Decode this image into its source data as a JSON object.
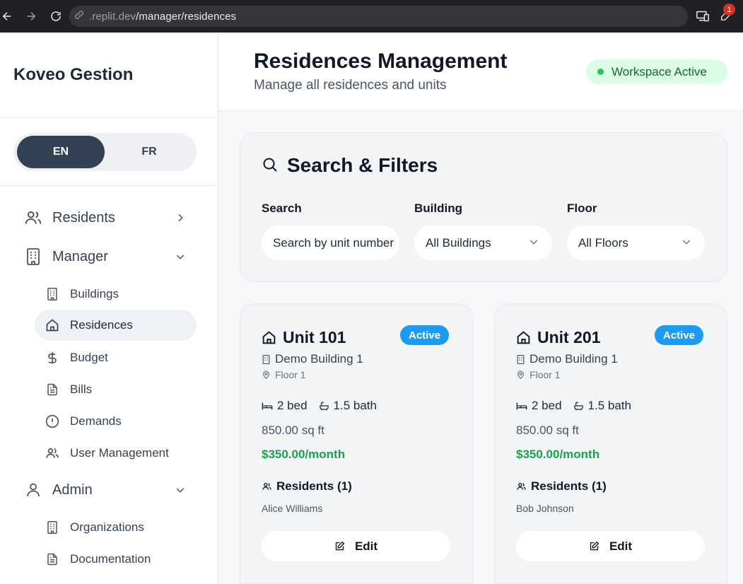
{
  "browser": {
    "url_domain": ".replit.dev",
    "url_path": "/manager/residences",
    "notification_count": "1"
  },
  "sidebar": {
    "brand": "Koveo Gestion",
    "lang": {
      "en": "EN",
      "fr": "FR",
      "selected": "EN"
    },
    "groups": [
      {
        "label": "Residents",
        "icon": "users-icon",
        "expanded": false
      },
      {
        "label": "Manager",
        "icon": "building-icon",
        "expanded": true,
        "items": [
          {
            "label": "Buildings",
            "icon": "building-icon"
          },
          {
            "label": "Residences",
            "icon": "home-icon",
            "active": true
          },
          {
            "label": "Budget",
            "icon": "dollar-icon"
          },
          {
            "label": "Bills",
            "icon": "file-text-icon"
          },
          {
            "label": "Demands",
            "icon": "alert-circle-icon"
          },
          {
            "label": "User Management",
            "icon": "users-icon"
          }
        ]
      },
      {
        "label": "Admin",
        "icon": "user-icon",
        "expanded": true,
        "items": [
          {
            "label": "Organizations",
            "icon": "building-icon"
          },
          {
            "label": "Documentation",
            "icon": "file-text-icon"
          }
        ]
      }
    ]
  },
  "header": {
    "title": "Residences Management",
    "subtitle": "Manage all residences and units",
    "status": "Workspace Active"
  },
  "filters": {
    "title": "Search & Filters",
    "search_label": "Search",
    "search_placeholder": "Search by unit number",
    "building_label": "Building",
    "building_value": "All Buildings",
    "floor_label": "Floor",
    "floor_value": "All Floors"
  },
  "units": [
    {
      "title": "Unit 101",
      "status": "Active",
      "building": "Demo Building 1",
      "floor": "Floor 1",
      "beds": "2 bed",
      "baths": "1.5 bath",
      "area": "850.00 sq ft",
      "rent": "$350.00/month",
      "residents_heading": "Residents (1)",
      "resident_names": "Alice Williams",
      "edit_label": "Edit"
    },
    {
      "title": "Unit 201",
      "status": "Active",
      "building": "Demo Building 1",
      "floor": "Floor 1",
      "beds": "2 bed",
      "baths": "1.5 bath",
      "area": "850.00 sq ft",
      "rent": "$350.00/month",
      "residents_heading": "Residents (1)",
      "resident_names": "Bob Johnson",
      "edit_label": "Edit"
    }
  ],
  "colors": {
    "accent_dark": "#334155",
    "status_blue": "#1d9bf0",
    "rent_green": "#16a34a",
    "workspace_green": "#22c55e"
  }
}
